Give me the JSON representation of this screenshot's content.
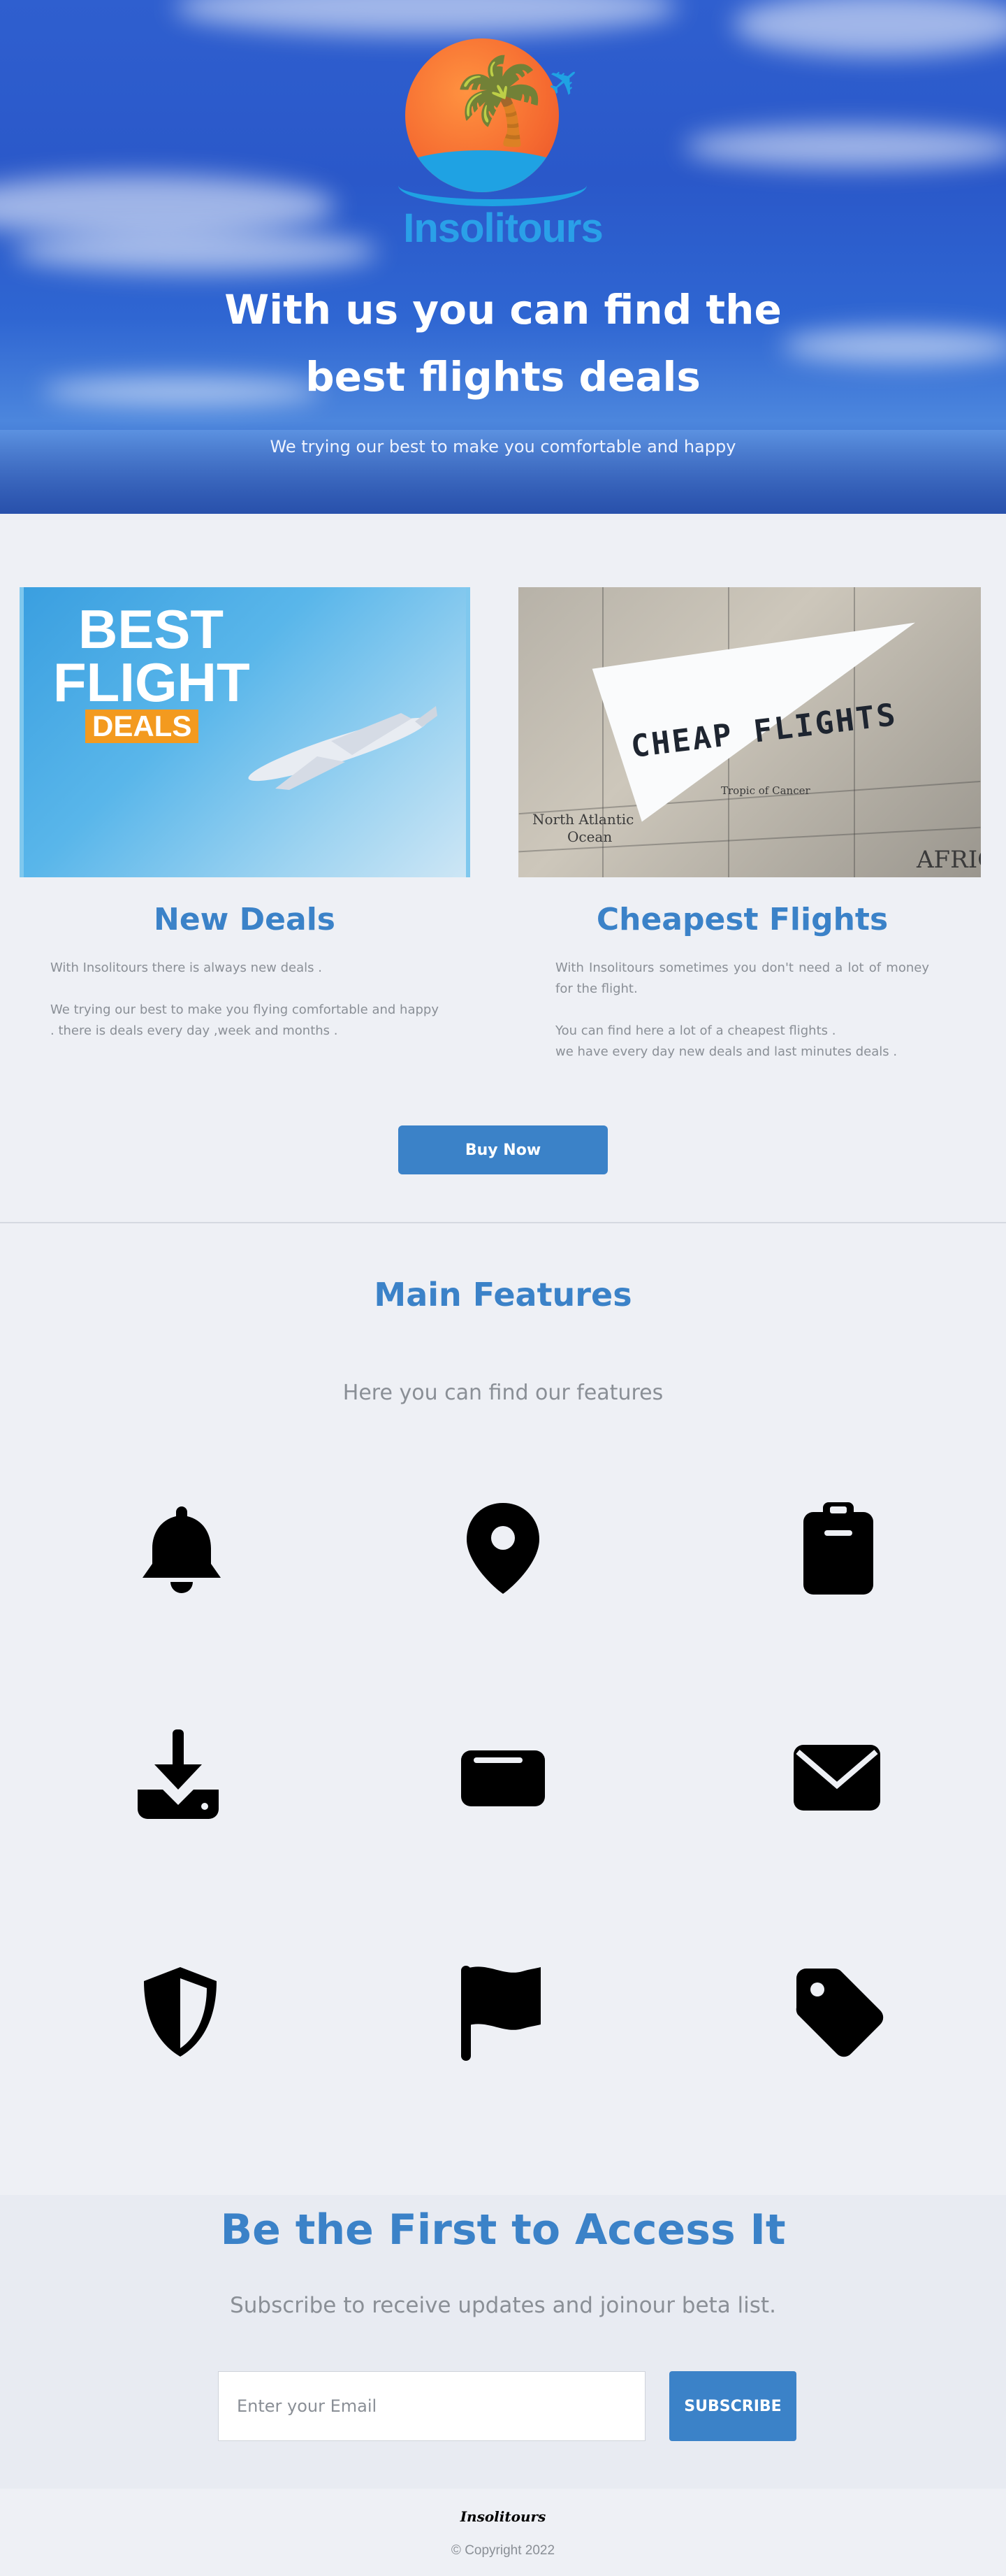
{
  "hero": {
    "brand": "Insolitours",
    "title": "With us you can find the best flights deals",
    "subtitle": "We trying our best to make you comfortable and happy"
  },
  "deals": {
    "left_image": {
      "line1": "BEST",
      "line2": "FLIGHT",
      "badge": "DEALS"
    },
    "right_image": {
      "stamp": "CHEAP FLIGHTS",
      "map_labels": [
        "North Atlantic",
        "Ocean",
        "Tropic of Cancer",
        "AFRIC"
      ]
    },
    "new_deals": {
      "title": "New Deals",
      "p1": "With Insolitours there is always new deals .",
      "p2": "We trying our best to make you flying comfortable and happy . there is deals every day ,week and months ."
    },
    "cheapest": {
      "title": "Cheapest Flights",
      "p1": "With Insolitours sometimes you don't need a lot of money for the flight.",
      "p2": "You can find  here a lot of a cheapest flights .",
      "p3": "we have every day new deals and last minutes deals ."
    },
    "buy_label": "Buy Now"
  },
  "features": {
    "title": "Main Features",
    "subtitle": "Here you can find our features",
    "icons": [
      "bell-icon",
      "map-pin-icon",
      "clipboard-icon",
      "download-icon",
      "wallet-icon",
      "envelope-icon",
      "shield-icon",
      "flag-icon",
      "tag-icon"
    ]
  },
  "subscribe": {
    "title": "Be the First to Access It",
    "subtitle": "Subscribe to receive updates and joinour beta list.",
    "placeholder": "Enter your Email",
    "button": "SUBSCRIBE"
  },
  "footer": {
    "brand": "Insolitours",
    "copyright": "© Copyright 2022"
  },
  "colors": {
    "accent": "#3b82c8",
    "background": "#eef0f5",
    "muted_text": "#8a8f96"
  }
}
